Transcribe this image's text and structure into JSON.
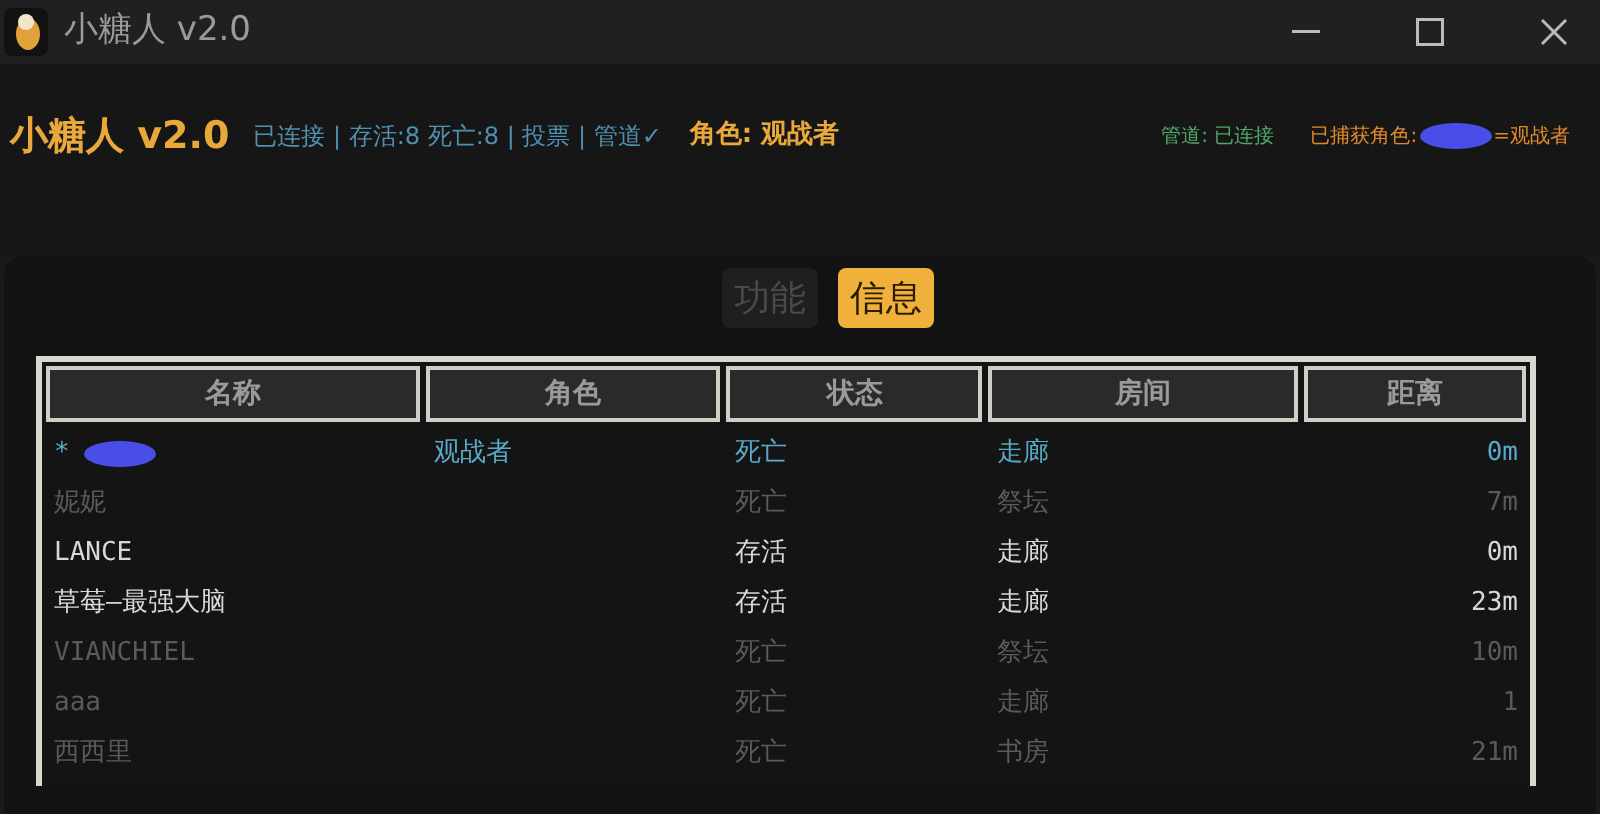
{
  "window": {
    "title": "小糖人 v2.0"
  },
  "header": {
    "app_name": "小糖人 v2.0",
    "status_line": "已连接 | 存活:8 死亡:8 | 投票 | 管道✓",
    "role": "角色: 观战者",
    "pipe": "管道: 已连接",
    "captured_label": "已捕获角色:",
    "captured_role": "=观战者"
  },
  "tabs": [
    {
      "label": "功能",
      "selected": false
    },
    {
      "label": "信息",
      "selected": true
    }
  ],
  "table": {
    "columns": [
      "名称",
      "角色",
      "状态",
      "房间",
      "距离"
    ],
    "rows": [
      {
        "kind": "self",
        "name": "*",
        "redacted": true,
        "role": "观战者",
        "status": "死亡",
        "room": "走廊",
        "distance": "0m"
      },
      {
        "kind": "dead",
        "name": "妮妮",
        "status": "死亡",
        "room": "祭坛",
        "distance": "7m"
      },
      {
        "kind": "alive",
        "name": "LANCE",
        "status": "存活",
        "room": "走廊",
        "distance": "0m"
      },
      {
        "kind": "alive",
        "name": "草莓–最强大脑",
        "status": "存活",
        "room": "走廊",
        "distance": "23m"
      },
      {
        "kind": "dead",
        "name": "VIANCHIEL",
        "status": "死亡",
        "room": "祭坛",
        "distance": "10m"
      },
      {
        "kind": "dead",
        "name": "aaa",
        "status": "死亡",
        "room": "走廊",
        "distance": "1"
      },
      {
        "kind": "dead",
        "name": "西西里",
        "status": "死亡",
        "room": "书房",
        "distance": "21m"
      }
    ]
  }
}
